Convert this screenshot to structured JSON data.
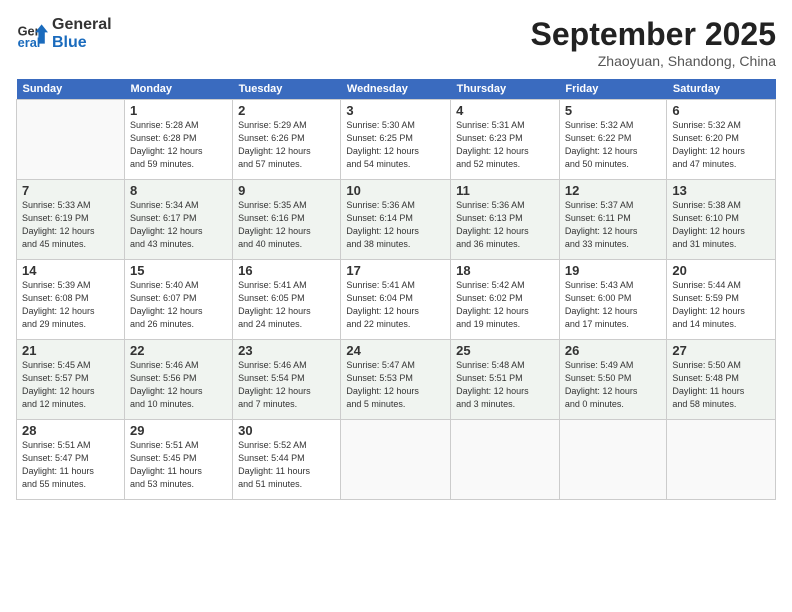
{
  "header": {
    "logo_line1": "General",
    "logo_line2": "Blue",
    "month": "September 2025",
    "location": "Zhaoyuan, Shandong, China"
  },
  "weekdays": [
    "Sunday",
    "Monday",
    "Tuesday",
    "Wednesday",
    "Thursday",
    "Friday",
    "Saturday"
  ],
  "weeks": [
    [
      {
        "day": "",
        "info": ""
      },
      {
        "day": "1",
        "info": "Sunrise: 5:28 AM\nSunset: 6:28 PM\nDaylight: 12 hours\nand 59 minutes."
      },
      {
        "day": "2",
        "info": "Sunrise: 5:29 AM\nSunset: 6:26 PM\nDaylight: 12 hours\nand 57 minutes."
      },
      {
        "day": "3",
        "info": "Sunrise: 5:30 AM\nSunset: 6:25 PM\nDaylight: 12 hours\nand 54 minutes."
      },
      {
        "day": "4",
        "info": "Sunrise: 5:31 AM\nSunset: 6:23 PM\nDaylight: 12 hours\nand 52 minutes."
      },
      {
        "day": "5",
        "info": "Sunrise: 5:32 AM\nSunset: 6:22 PM\nDaylight: 12 hours\nand 50 minutes."
      },
      {
        "day": "6",
        "info": "Sunrise: 5:32 AM\nSunset: 6:20 PM\nDaylight: 12 hours\nand 47 minutes."
      }
    ],
    [
      {
        "day": "7",
        "info": "Sunrise: 5:33 AM\nSunset: 6:19 PM\nDaylight: 12 hours\nand 45 minutes."
      },
      {
        "day": "8",
        "info": "Sunrise: 5:34 AM\nSunset: 6:17 PM\nDaylight: 12 hours\nand 43 minutes."
      },
      {
        "day": "9",
        "info": "Sunrise: 5:35 AM\nSunset: 6:16 PM\nDaylight: 12 hours\nand 40 minutes."
      },
      {
        "day": "10",
        "info": "Sunrise: 5:36 AM\nSunset: 6:14 PM\nDaylight: 12 hours\nand 38 minutes."
      },
      {
        "day": "11",
        "info": "Sunrise: 5:36 AM\nSunset: 6:13 PM\nDaylight: 12 hours\nand 36 minutes."
      },
      {
        "day": "12",
        "info": "Sunrise: 5:37 AM\nSunset: 6:11 PM\nDaylight: 12 hours\nand 33 minutes."
      },
      {
        "day": "13",
        "info": "Sunrise: 5:38 AM\nSunset: 6:10 PM\nDaylight: 12 hours\nand 31 minutes."
      }
    ],
    [
      {
        "day": "14",
        "info": "Sunrise: 5:39 AM\nSunset: 6:08 PM\nDaylight: 12 hours\nand 29 minutes."
      },
      {
        "day": "15",
        "info": "Sunrise: 5:40 AM\nSunset: 6:07 PM\nDaylight: 12 hours\nand 26 minutes."
      },
      {
        "day": "16",
        "info": "Sunrise: 5:41 AM\nSunset: 6:05 PM\nDaylight: 12 hours\nand 24 minutes."
      },
      {
        "day": "17",
        "info": "Sunrise: 5:41 AM\nSunset: 6:04 PM\nDaylight: 12 hours\nand 22 minutes."
      },
      {
        "day": "18",
        "info": "Sunrise: 5:42 AM\nSunset: 6:02 PM\nDaylight: 12 hours\nand 19 minutes."
      },
      {
        "day": "19",
        "info": "Sunrise: 5:43 AM\nSunset: 6:00 PM\nDaylight: 12 hours\nand 17 minutes."
      },
      {
        "day": "20",
        "info": "Sunrise: 5:44 AM\nSunset: 5:59 PM\nDaylight: 12 hours\nand 14 minutes."
      }
    ],
    [
      {
        "day": "21",
        "info": "Sunrise: 5:45 AM\nSunset: 5:57 PM\nDaylight: 12 hours\nand 12 minutes."
      },
      {
        "day": "22",
        "info": "Sunrise: 5:46 AM\nSunset: 5:56 PM\nDaylight: 12 hours\nand 10 minutes."
      },
      {
        "day": "23",
        "info": "Sunrise: 5:46 AM\nSunset: 5:54 PM\nDaylight: 12 hours\nand 7 minutes."
      },
      {
        "day": "24",
        "info": "Sunrise: 5:47 AM\nSunset: 5:53 PM\nDaylight: 12 hours\nand 5 minutes."
      },
      {
        "day": "25",
        "info": "Sunrise: 5:48 AM\nSunset: 5:51 PM\nDaylight: 12 hours\nand 3 minutes."
      },
      {
        "day": "26",
        "info": "Sunrise: 5:49 AM\nSunset: 5:50 PM\nDaylight: 12 hours\nand 0 minutes."
      },
      {
        "day": "27",
        "info": "Sunrise: 5:50 AM\nSunset: 5:48 PM\nDaylight: 11 hours\nand 58 minutes."
      }
    ],
    [
      {
        "day": "28",
        "info": "Sunrise: 5:51 AM\nSunset: 5:47 PM\nDaylight: 11 hours\nand 55 minutes."
      },
      {
        "day": "29",
        "info": "Sunrise: 5:51 AM\nSunset: 5:45 PM\nDaylight: 11 hours\nand 53 minutes."
      },
      {
        "day": "30",
        "info": "Sunrise: 5:52 AM\nSunset: 5:44 PM\nDaylight: 11 hours\nand 51 minutes."
      },
      {
        "day": "",
        "info": ""
      },
      {
        "day": "",
        "info": ""
      },
      {
        "day": "",
        "info": ""
      },
      {
        "day": "",
        "info": ""
      }
    ]
  ]
}
